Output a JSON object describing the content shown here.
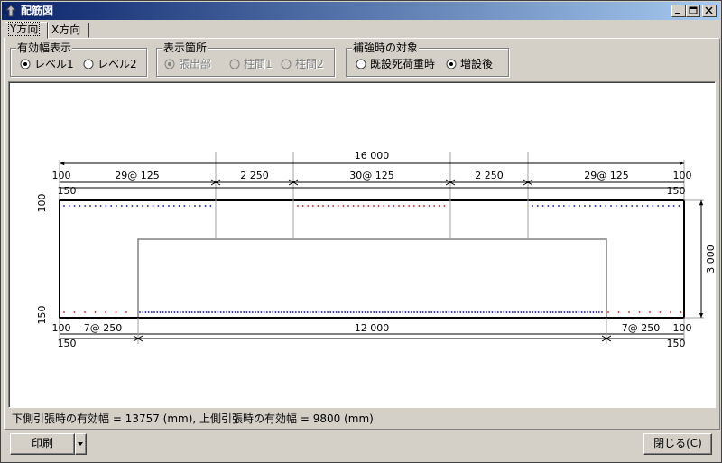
{
  "window": {
    "title": "配筋図"
  },
  "tabs": [
    {
      "label": "Y方向",
      "active": true
    },
    {
      "label": "X方向",
      "active": false
    }
  ],
  "groups": {
    "effective_width": {
      "legend": "有効幅表示",
      "options": [
        {
          "label": "レベル1",
          "checked": true
        },
        {
          "label": "レベル2",
          "checked": false
        }
      ]
    },
    "display_location": {
      "legend": "表示箇所",
      "options": [
        {
          "label": "張出部",
          "checked": true,
          "disabled": true
        },
        {
          "label": "柱間1",
          "checked": false,
          "disabled": true
        },
        {
          "label": "柱間2",
          "checked": false,
          "disabled": true
        }
      ]
    },
    "reinforcement_target": {
      "legend": "補強時の対象",
      "options": [
        {
          "label": "既設死荷重時",
          "checked": false
        },
        {
          "label": "増設後",
          "checked": true
        }
      ]
    }
  },
  "drawing": {
    "overall_width": "16 000",
    "top_dims": [
      "100",
      "29@ 125",
      "2 250",
      "30@ 125",
      "2 250",
      "29@ 125",
      "100"
    ],
    "top_sub_left": "150",
    "top_sub_right": "150",
    "bottom_dims": [
      "100",
      "7@ 250",
      "12 000",
      "7@ 250",
      "100"
    ],
    "bottom_sub_left": "150",
    "bottom_sub_right": "150",
    "height": "3 000",
    "left_top_cover": "100",
    "left_bottom_cover": "150"
  },
  "status_text": "下側引張時の有効幅 = 13757 (mm), 上側引張時の有効幅 = 9800 (mm)",
  "buttons": {
    "print": "印刷",
    "close": "閉じる(C)"
  },
  "colors": {
    "title_start": "#0a246a",
    "title_end": "#a6caf0",
    "rebar_red": "#e00000",
    "rebar_blue": "#0000c0"
  }
}
